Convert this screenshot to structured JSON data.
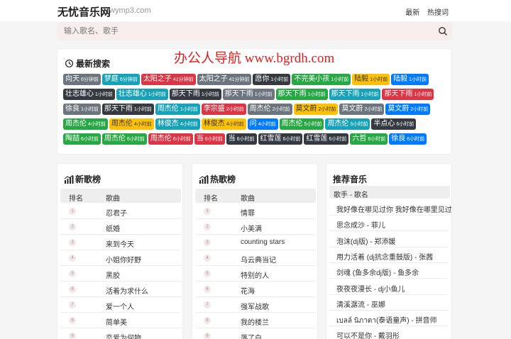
{
  "header": {
    "logo": "无忧音乐网",
    "domain": "wymp3.com",
    "nav": [
      {
        "label": "最新"
      },
      {
        "label": "热搜词"
      }
    ]
  },
  "search": {
    "placeholder": "输入歌名、歌手"
  },
  "watermark": "办公人导航 www.bgrdh.com",
  "recent": {
    "title": "最新搜索",
    "rows": [
      [
        {
          "name": "向天",
          "time": "6分钟前",
          "color": "#6c757d"
        },
        {
          "name": "梦庭",
          "time": "6分钟前",
          "color": "#17a2b8"
        },
        {
          "name": "太阳之子",
          "time": "41分钟前",
          "color": "#dc3545"
        },
        {
          "name": "太阳之子",
          "time": "41分钟前",
          "color": "#6c757d"
        },
        {
          "name": "愿你",
          "time": "1小时前",
          "color": "#343a40"
        },
        {
          "name": "不完美小孩",
          "time": "1小时前",
          "color": "#28a745"
        },
        {
          "name": "陆毅",
          "time": "1小时前",
          "color": "#ffc107",
          "dark": true
        },
        {
          "name": "陆毅",
          "time": "1小时前",
          "color": "#007bff"
        }
      ],
      [
        {
          "name": "壮志雄心",
          "time": "1小时前",
          "color": "#343a40"
        },
        {
          "name": "壮志雄心",
          "time": "1小时前",
          "color": "#17a2b8"
        },
        {
          "name": "那天下雨",
          "time": "1小时前",
          "color": "#343a40"
        },
        {
          "name": "那天下雨",
          "time": "1小时前",
          "color": "#6c757d"
        },
        {
          "name": "那天下雨",
          "time": "1小时前",
          "color": "#28a745"
        },
        {
          "name": "那天下雨",
          "time": "1小时前",
          "color": "#17a2b8"
        },
        {
          "name": "那天下雨",
          "time": "1小时前",
          "color": "#dc3545"
        }
      ],
      [
        {
          "name": "徐良",
          "time": "1小时前",
          "color": "#6c757d"
        },
        {
          "name": "那天下雨",
          "time": "1小时前",
          "color": "#343a40"
        },
        {
          "name": "周杰伦",
          "time": "1小时前",
          "color": "#17a2b8"
        },
        {
          "name": "李宗盛",
          "time": "2小时前",
          "color": "#dc3545"
        },
        {
          "name": "周杰伦",
          "time": "2小时前",
          "color": "#6c757d"
        },
        {
          "name": "莫文蔚",
          "time": "2小时前",
          "color": "#ffc107",
          "dark": true
        },
        {
          "name": "莫文蔚",
          "time": "2小时前",
          "color": "#6c757d"
        },
        {
          "name": "莫文蔚",
          "time": "2小时前",
          "color": "#007bff"
        }
      ],
      [
        {
          "name": "周杰伦",
          "time": "4小时前",
          "color": "#28a745"
        },
        {
          "name": "周杰伦",
          "time": "4小时前",
          "color": "#ffc107",
          "dark": true
        },
        {
          "name": "林俊杰",
          "time": "4小时前",
          "color": "#17a2b8"
        },
        {
          "name": "林俊杰",
          "time": "4小时前",
          "color": "#ffc107",
          "dark": true
        },
        {
          "name": "问",
          "time": "4小时前",
          "color": "#007bff"
        },
        {
          "name": "周杰伦",
          "time": "5小时前",
          "color": "#28a745"
        },
        {
          "name": "周杰伦",
          "time": "5小时前",
          "color": "#17a2b8"
        },
        {
          "name": "半点心",
          "time": "6小时前",
          "color": "#343a40"
        }
      ],
      [
        {
          "name": "陶喆",
          "time": "6小时前",
          "color": "#28a745"
        },
        {
          "name": "周杰伦",
          "time": "6小时前",
          "color": "#28a745"
        },
        {
          "name": "周杰伦",
          "time": "6小时前",
          "color": "#dc3545"
        },
        {
          "name": "当",
          "time": "6小时前",
          "color": "#dc3545"
        },
        {
          "name": "当",
          "time": "6小时前",
          "color": "#343a40"
        },
        {
          "name": "红雪莲",
          "time": "6小时前",
          "color": "#343a40"
        },
        {
          "name": "红雪莲",
          "time": "6小时前",
          "color": "#343a40"
        },
        {
          "name": "六哲",
          "time": "6小时前",
          "color": "#28a745"
        },
        {
          "name": "徐良",
          "time": "6小时前",
          "color": "#007bff"
        }
      ]
    ]
  },
  "new_chart": {
    "title": "新歌榜",
    "col_rank": "排名",
    "col_song": "歌曲",
    "rows": [
      {
        "rank": "1",
        "song": "忍君子"
      },
      {
        "rank": "2",
        "song": "纸婚"
      },
      {
        "rank": "3",
        "song": "来到今天"
      },
      {
        "rank": "4",
        "song": "小姐你好野"
      },
      {
        "rank": "5",
        "song": "黑胶"
      },
      {
        "rank": "6",
        "song": "活着为求什么"
      },
      {
        "rank": "7",
        "song": "爱一个人"
      },
      {
        "rank": "8",
        "song": "简单美"
      },
      {
        "rank": "9",
        "song": "恋爱为何物"
      }
    ]
  },
  "hot_chart": {
    "title": "热歌榜",
    "col_rank": "排名",
    "col_song": "歌曲",
    "rows": [
      {
        "rank": "1",
        "song": "情罪"
      },
      {
        "rank": "2",
        "song": "小美满"
      },
      {
        "rank": "3",
        "song": "counting stars"
      },
      {
        "rank": "4",
        "song": "乌云典当记"
      },
      {
        "rank": "5",
        "song": "特别的人"
      },
      {
        "rank": "6",
        "song": "花海"
      },
      {
        "rank": "7",
        "song": "强军战歌"
      },
      {
        "rank": "8",
        "song": "我的楼兰"
      },
      {
        "rank": "9",
        "song": "落了白"
      }
    ]
  },
  "recommend": {
    "title": "推荐音乐",
    "header": "歌手 - 歌名",
    "rows": [
      "我好像在哪见过你 我好像在哪里见过你",
      "思念成沙 - 菲儿",
      "泡沫(dj版) - 郑添媛",
      "用力活着 (dj抗念重鼓版) - 张茜",
      "剑魂 (鱼多余dj版) - 鱼多余",
      "夜夜夜漫长 - dj小鱼儿",
      "清溪潺流 - 巫娜",
      "เบลล์ นิภาดา(泰语童声) - 拼音师",
      "可以不是你 - 戴羽彤"
    ]
  }
}
